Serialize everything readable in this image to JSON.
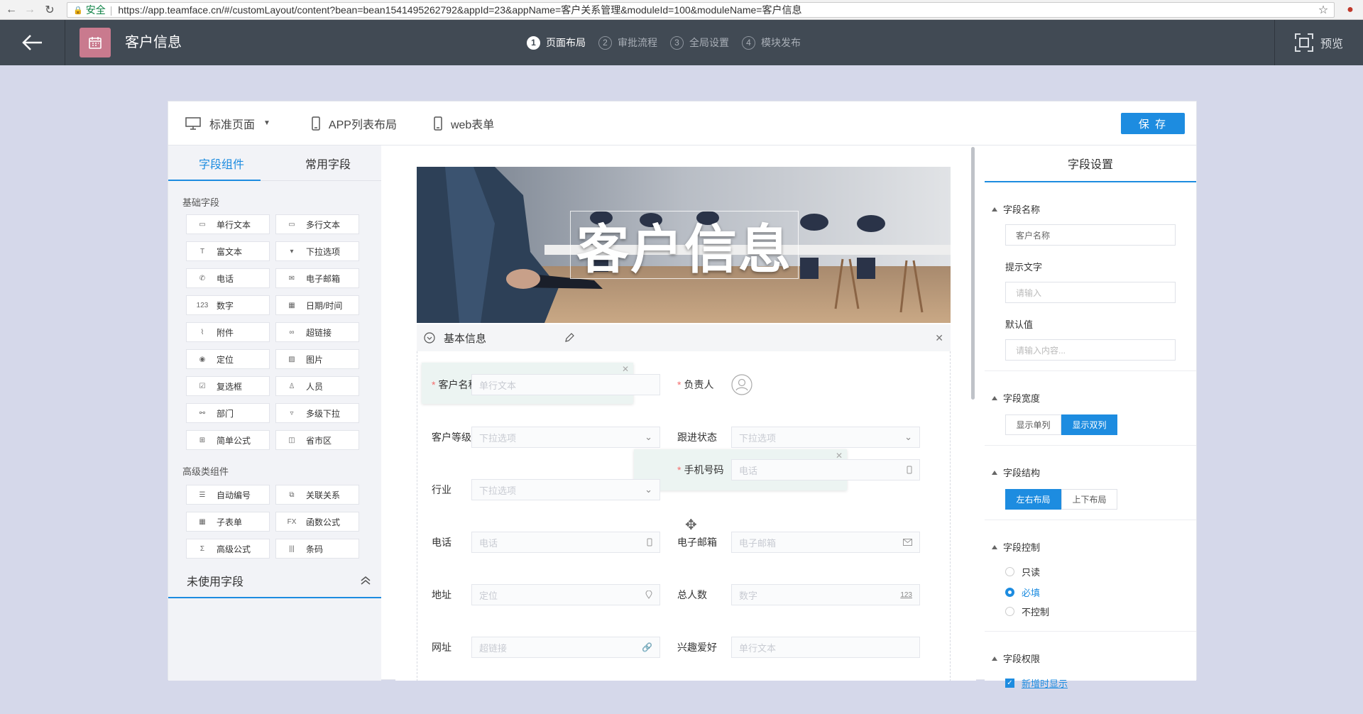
{
  "browser": {
    "security": "安全",
    "url": "https://app.teamface.cn/#/customLayout/content?bean=bean1541495262792&appId=23&appName=客户关系管理&moduleId=100&moduleName=客户信息"
  },
  "header": {
    "title": "客户信息",
    "steps": [
      {
        "num": "1",
        "label": "页面布局"
      },
      {
        "num": "2",
        "label": "审批流程"
      },
      {
        "num": "3",
        "label": "全局设置"
      },
      {
        "num": "4",
        "label": "模块发布"
      }
    ],
    "preview": "预览"
  },
  "toolbar": {
    "standard": "标准页面",
    "app_list": "APP列表布局",
    "web_form": "web表单",
    "save": "保 存"
  },
  "left": {
    "tabs": [
      "字段组件",
      "常用字段"
    ],
    "basic_title": "基础字段",
    "basic": [
      {
        "label": "单行文本",
        "icon": "single-text-icon"
      },
      {
        "label": "多行文本",
        "icon": "multi-text-icon"
      },
      {
        "label": "富文本",
        "icon": "rich-text-icon"
      },
      {
        "label": "下拉选项",
        "icon": "dropdown-icon"
      },
      {
        "label": "电话",
        "icon": "phone-icon"
      },
      {
        "label": "电子邮箱",
        "icon": "email-icon"
      },
      {
        "label": "数字",
        "icon": "number-icon"
      },
      {
        "label": "日期/时间",
        "icon": "calendar-icon"
      },
      {
        "label": "附件",
        "icon": "attachment-icon"
      },
      {
        "label": "超链接",
        "icon": "link-icon"
      },
      {
        "label": "定位",
        "icon": "location-icon"
      },
      {
        "label": "图片",
        "icon": "image-icon"
      },
      {
        "label": "复选框",
        "icon": "checkbox-icon"
      },
      {
        "label": "人员",
        "icon": "person-icon"
      },
      {
        "label": "部门",
        "icon": "department-icon"
      },
      {
        "label": "多级下拉",
        "icon": "multilevel-dropdown-icon"
      },
      {
        "label": "简单公式",
        "icon": "formula-icon"
      },
      {
        "label": "省市区",
        "icon": "region-icon"
      }
    ],
    "advanced_title": "高级类组件",
    "advanced": [
      {
        "label": "自动编号",
        "icon": "auto-number-icon"
      },
      {
        "label": "关联关系",
        "icon": "relation-icon"
      },
      {
        "label": "子表单",
        "icon": "subform-icon"
      },
      {
        "label": "函数公式",
        "icon": "function-icon"
      },
      {
        "label": "高级公式",
        "icon": "sigma-icon"
      },
      {
        "label": "条码",
        "icon": "barcode-icon"
      }
    ],
    "unused": "未使用字段"
  },
  "canvas": {
    "banner_title": "客户信息",
    "section_title": "基本信息",
    "fields": {
      "customer_name": {
        "label": "客户名称",
        "ph": "单行文本"
      },
      "owner": {
        "label": "负责人"
      },
      "level": {
        "label": "客户等级",
        "ph": "下拉选项"
      },
      "follow": {
        "label": "跟进状态",
        "ph": "下拉选项"
      },
      "industry": {
        "label": "行业",
        "ph": "下拉选项"
      },
      "mobile": {
        "label": "手机号码",
        "ph": "电话"
      },
      "phone": {
        "label": "电话",
        "ph": "电话"
      },
      "email": {
        "label": "电子邮箱",
        "ph": "电子邮箱"
      },
      "address": {
        "label": "地址",
        "ph": "定位"
      },
      "headcount": {
        "label": "总人数",
        "ph": "数字"
      },
      "website": {
        "label": "网址",
        "ph": "超链接"
      },
      "hobby": {
        "label": "兴趣爱好",
        "ph": "单行文本"
      }
    },
    "number_badge": "123"
  },
  "right": {
    "header": "字段设置",
    "name_title": "字段名称",
    "name_value": "客户名称",
    "hint_title": "提示文字",
    "hint_ph": "请输入",
    "default_title": "默认值",
    "default_ph": "请输入内容...",
    "width_title": "字段宽度",
    "width_opts": [
      "显示单列",
      "显示双列"
    ],
    "struct_title": "字段结构",
    "struct_opts": [
      "左右布局",
      "上下布局"
    ],
    "control_title": "字段控制",
    "control_opts": [
      "只读",
      "必填",
      "不控制"
    ],
    "perm_title": "字段权限",
    "perm_opt": "新增时显示"
  },
  "colors": {
    "accent": "#1d8ce0",
    "header_bg": "#414a54",
    "required": "#f56c6c"
  }
}
